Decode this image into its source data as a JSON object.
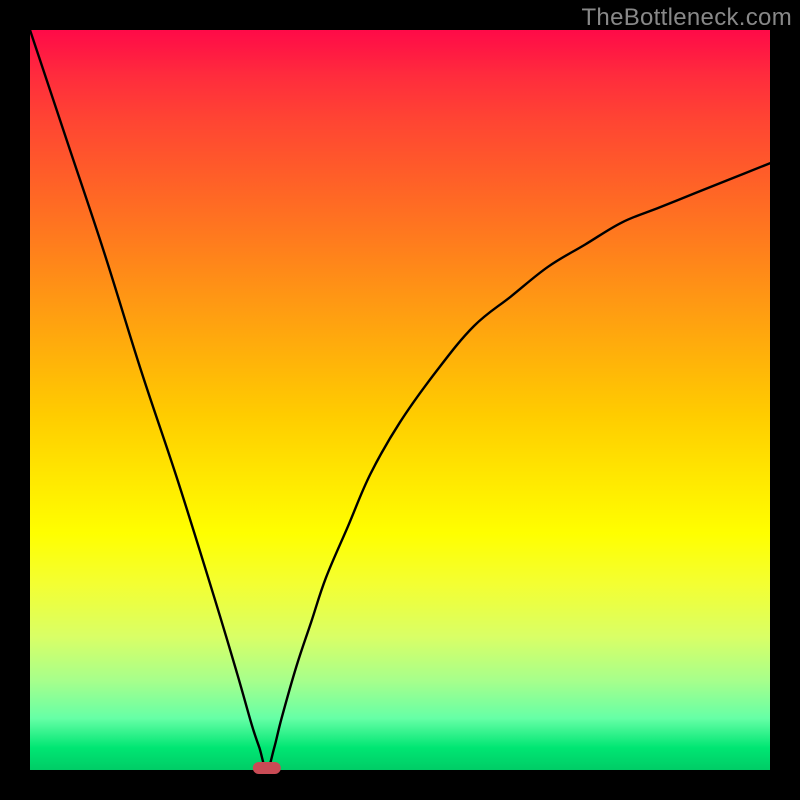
{
  "watermark": "TheBottleneck.com",
  "colors": {
    "frame": "#000000",
    "curve": "#000000",
    "marker": "#c94b55"
  },
  "chart_data": {
    "type": "line",
    "title": "",
    "xlabel": "",
    "ylabel": "",
    "xlim": [
      0,
      100
    ],
    "ylim": [
      0,
      100
    ],
    "grid": false,
    "legend": false,
    "background": "vertical rainbow gradient (red top → green bottom)",
    "series": [
      {
        "name": "bottleneck-curve",
        "description": "V-shaped curve with sharp minimum near x≈32; left branch nearly linear descending from top-left, right branch rises and saturates toward y≈82 at right edge",
        "x": [
          0,
          5,
          10,
          15,
          20,
          25,
          28,
          30,
          31,
          32,
          33,
          34,
          36,
          38,
          40,
          43,
          46,
          50,
          55,
          60,
          65,
          70,
          75,
          80,
          85,
          90,
          95,
          100
        ],
        "y": [
          100,
          85,
          70,
          54,
          39,
          23,
          13,
          6,
          3,
          0,
          3,
          7,
          14,
          20,
          26,
          33,
          40,
          47,
          54,
          60,
          64,
          68,
          71,
          74,
          76,
          78,
          80,
          82
        ]
      }
    ],
    "marker": {
      "x": 32,
      "y": 0,
      "shape": "rounded-pill",
      "color": "#c94b55"
    }
  }
}
